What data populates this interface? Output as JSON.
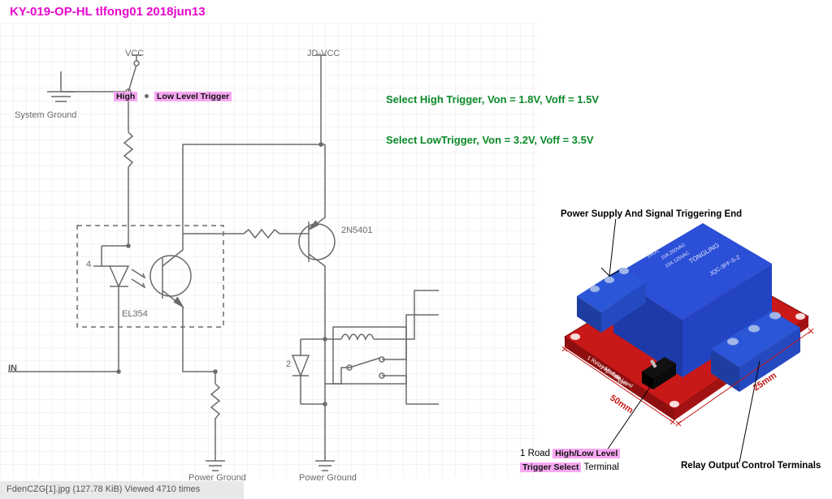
{
  "title": "KY-019-OP-HL tlfong01 2018jun13",
  "circuit": {
    "vcc": "VCC",
    "jdvcc": "JD-VCC",
    "system_ground": "System Ground",
    "power_ground_1": "Power Ground",
    "power_ground_2": "Power Ground",
    "in_label": "IN",
    "high_pin": "High",
    "low_level_trigger": "Low Level Trigger",
    "optocoupler_ref": "EL354",
    "optocoupler_pin4": "4",
    "diode_pin2": "2",
    "transistor_ref": "2N5401"
  },
  "select_high": "Select High Trigger, Von = 1.8V, Voff = 1.5V",
  "select_low": "Select LowTrigger, Von = 3.2V, Voff = 3.5V",
  "module": {
    "power_signal_end": "Power Supply And Signal Triggering End",
    "dim_50mm": "50mm",
    "dim_25mm": "25mm",
    "road_prefix": "1 Road ",
    "highlow_level": "High/Low Level",
    "trigger_select": "Trigger Select",
    "terminal_suffix": " Terminal",
    "output_control": "Relay Output Control Terminals",
    "pcb_text_1": "1 Relay Module",
    "pcb_text_2": "High/Low Level",
    "pcb_text_3": "Trigger",
    "relay_brand": "TONGLING",
    "relay_part": "JQC-3FF-S-Z",
    "relay_spec1": "10A 250VAC",
    "relay_spec2": "10A 125VAC",
    "relay_spec3": "5VDC"
  },
  "file_status": "FdenCZG[1].jpg (127.78 KiB) Viewed 4710 times"
}
